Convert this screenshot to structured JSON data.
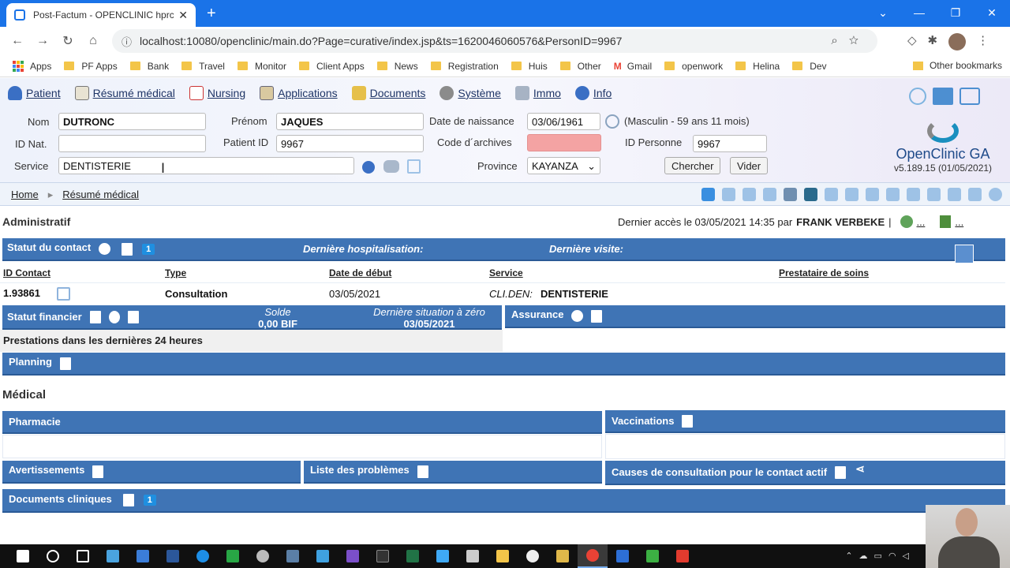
{
  "browser": {
    "tab_title": "Post-Factum - OPENCLINIC hprc",
    "url": "localhost:10080/openclinic/main.do?Page=curative/index.jsp&ts=1620046060576&PersonID=9967",
    "bookmarks": [
      "Apps",
      "PF Apps",
      "Bank",
      "Travel",
      "Monitor",
      "Client Apps",
      "News",
      "Registration",
      "Huis",
      "Other",
      "Gmail",
      "openwork",
      "Helina",
      "Dev"
    ],
    "other_bookmarks": "Other bookmarks"
  },
  "menu": {
    "patient": "Patient",
    "resume": "Résumé médical",
    "nursing": "Nursing",
    "applications": "Applications",
    "documents": "Documents",
    "systeme": "Système",
    "immo": "Immo",
    "info": "Info"
  },
  "form": {
    "nom_label": "Nom",
    "nom_value": "DUTRONC",
    "prenom_label": "Prénom",
    "prenom_value": "JAQUES",
    "naissance_label": "Date de naissance",
    "naissance_value": "03/06/1961",
    "age_text": "(Masculin - 59 ans 11 mois)",
    "idnat_label": "ID Nat.",
    "idnat_value": "",
    "patientid_label": "Patient ID",
    "patientid_value": "9967",
    "archives_label": "Code d´archives",
    "idpersonne_label": "ID Personne",
    "idpersonne_value": "9967",
    "service_label": "Service",
    "service_value": "DENTISTERIE",
    "province_label": "Province",
    "province_value": "KAYANZA",
    "chercher": "Chercher",
    "vider": "Vider"
  },
  "logo": {
    "name": "OpenClinic GA",
    "version": "v5.189.15 (01/05/2021)"
  },
  "breadcrumb": {
    "home": "Home",
    "current": "Résumé médical"
  },
  "admin": {
    "title": "Administratif",
    "last_access": "Dernier accès le 03/05/2021 14:35 par",
    "user": "FRANK VERBEKE",
    "sep": "|",
    "more1": "...",
    "more2": "..."
  },
  "contact": {
    "title": "Statut du contact",
    "badge": "1",
    "last_hosp": "Dernière hospitalisation:",
    "last_visit": "Dernière visite:",
    "headers": {
      "id": "ID Contact",
      "type": "Type",
      "start": "Date de début",
      "service": "Service",
      "provider": "Prestataire de soins"
    },
    "row": {
      "id": "1.93861",
      "type": "Consultation",
      "start": "03/05/2021",
      "service_code": "CLI.DEN:",
      "service_name": "DENTISTERIE",
      "provider": ""
    }
  },
  "finance": {
    "title": "Statut financier",
    "solde_label": "Solde",
    "solde_value": "0,00 BIF",
    "zero_label": "Dernière situation à zéro",
    "zero_value": "03/05/2021",
    "prestations": "Prestations dans les dernières 24 heures"
  },
  "assurance": {
    "title": "Assurance"
  },
  "planning": {
    "title": "Planning"
  },
  "medical": {
    "title": "Médical",
    "pharmacie": "Pharmacie",
    "vaccinations": "Vaccinations",
    "avertissements": "Avertissements",
    "problemes": "Liste des problèmes",
    "causes": "Causes de consultation pour le contact actif",
    "documents": "Documents cliniques",
    "documents_badge": "1"
  },
  "colors": {
    "bar": "#3f74b5",
    "accent": "#1a73e8",
    "archive_field": "#f4a3a3"
  }
}
